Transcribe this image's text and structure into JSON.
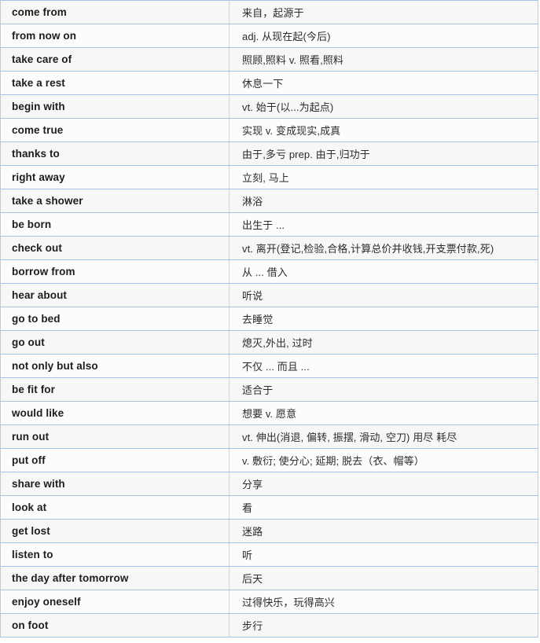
{
  "table": {
    "columns": [
      "term",
      "meaning"
    ],
    "rows": [
      {
        "term": "come from",
        "meaning": "来自，起源于"
      },
      {
        "term": "from now on",
        "meaning": "adj. 从现在起(今后)"
      },
      {
        "term": "take care of",
        "meaning": "照顾,照料 v. 照看,照料"
      },
      {
        "term": "take a rest",
        "meaning": "休息一下"
      },
      {
        "term": "begin with",
        "meaning": "vt. 始于(以...为起点)"
      },
      {
        "term": "come true",
        "meaning": "实现 v. 变成现实,成真"
      },
      {
        "term": "thanks to",
        "meaning": "由于,多亏 prep. 由于,归功于"
      },
      {
        "term": "right away",
        "meaning": "立刻, 马上"
      },
      {
        "term": "take a shower",
        "meaning": "淋浴"
      },
      {
        "term": "be born",
        "meaning": "出生于 ..."
      },
      {
        "term": "check out",
        "meaning": "vt. 离开(登记,检验,合格,计算总价并收钱,开支票付款,死)"
      },
      {
        "term": "borrow from",
        "meaning": "从 ... 借入"
      },
      {
        "term": "hear about",
        "meaning": "听说"
      },
      {
        "term": "go to bed",
        "meaning": "去睡觉"
      },
      {
        "term": "go out",
        "meaning": "熄灭,外出, 过时"
      },
      {
        "term": "not only but also",
        "meaning": "不仅 ... 而且 ..."
      },
      {
        "term": "be fit for",
        "meaning": "适合于"
      },
      {
        "term": "would like",
        "meaning": "想要 v. 愿意"
      },
      {
        "term": "run out",
        "meaning": "vt. 伸出(消退, 偏转, 振摆, 滑动, 空刀) 用尽 耗尽"
      },
      {
        "term": "put off",
        "meaning": "v. 敷衍; 使分心;  延期; 脱去（衣、帽等）"
      },
      {
        "term": "share with",
        "meaning": "分享"
      },
      {
        "term": "look at",
        "meaning": "看"
      },
      {
        "term": "get lost",
        "meaning": "迷路"
      },
      {
        "term": "listen to",
        "meaning": "听"
      },
      {
        "term": "the day after tomorrow",
        "meaning": "后天"
      },
      {
        "term": "enjoy oneself",
        "meaning": "过得快乐，玩得高兴"
      },
      {
        "term": "on foot",
        "meaning": "步行"
      }
    ]
  },
  "colors": {
    "row_border": "#a3c4e8",
    "row_odd_bg": "#f7f7f7",
    "row_even_bg": "#fcfcfc",
    "term_text": "#1d1d1d",
    "meaning_text": "#2b2b2b"
  }
}
